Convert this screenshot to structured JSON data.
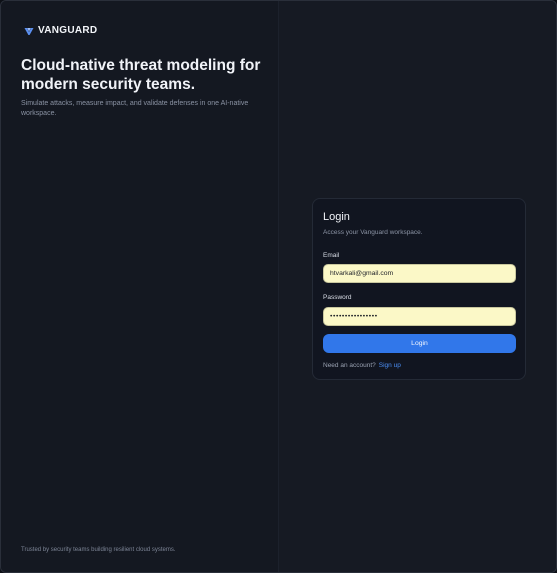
{
  "brand": {
    "name": "VANGUARD",
    "icon": "v-shield-icon",
    "icon_color": "#5b8ff0"
  },
  "hero": {
    "title": "Cloud-native threat modeling for modern security teams.",
    "subtitle": "Simulate attacks, measure impact, and validate defenses in one AI-native workspace."
  },
  "footer": {
    "note": "Trusted by security teams building resilient cloud systems."
  },
  "login": {
    "title": "Login",
    "subtitle": "Access your Vanguard workspace.",
    "email_label": "Email",
    "email_value": "htvarkali@gmail.com",
    "password_label": "Password",
    "password_value": "••••••••••••••••",
    "button_label": "Login",
    "signup_prompt": "Need an account?",
    "signup_link": "Sign up"
  },
  "colors": {
    "accent": "#3177ea",
    "link": "#4b8ef4",
    "autofill": "#fbf8c7",
    "background": "#151922"
  }
}
